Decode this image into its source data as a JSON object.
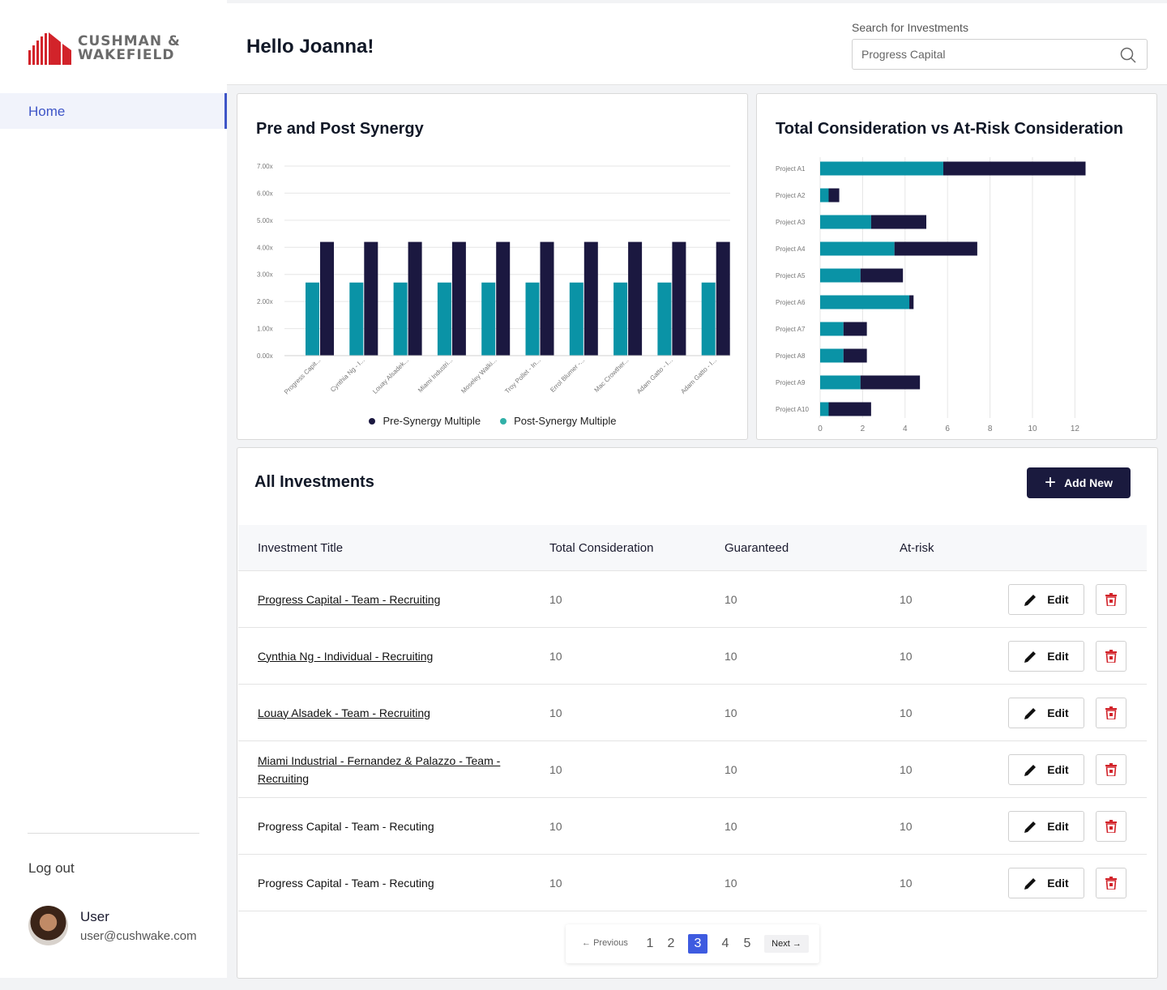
{
  "brand": {
    "name_line1": "CUSHMAN &",
    "name_line2": "WAKEFIELD",
    "accent": "#d2232a"
  },
  "sidebar": {
    "nav": [
      {
        "label": "Home",
        "active": true
      }
    ],
    "logout_label": "Log out",
    "user": {
      "name": "User",
      "email": "user@cushwake.com"
    }
  },
  "header": {
    "greeting": "Hello Joanna!",
    "search": {
      "label": "Search for Investments",
      "value": "Progress Capital",
      "placeholder": "Progress Capital"
    }
  },
  "colors": {
    "pre": "#1b1840",
    "post": "#0a93a6",
    "primary_button": "#1a1a3e",
    "active_page": "#3e5be0",
    "delete_icon": "#d2232a"
  },
  "charts": {
    "synergy": {
      "title": "Pre and Post Synergy"
    },
    "consideration": {
      "title": "Total Consideration vs At-Risk Consideration"
    }
  },
  "chart_data": [
    {
      "type": "bar",
      "title": "Pre and Post Synergy",
      "categories": [
        "Progress Capit...",
        "Cynthia Ng - I...",
        "Louay Alsadek...",
        "Miami Industri...",
        "Moseley Walki...",
        "Troy Pollet - In...",
        "Errol Blumer -...",
        "Mac Crowther...",
        "Adam Gatto - I...",
        "Adam Gatto - I..."
      ],
      "series": [
        {
          "name": "Pre-Synergy Multiple",
          "values": [
            4.2,
            4.2,
            4.2,
            4.2,
            4.2,
            4.2,
            4.2,
            4.2,
            4.2,
            4.2
          ]
        },
        {
          "name": "Post-Synergy Multiple",
          "values": [
            2.7,
            2.7,
            2.7,
            2.7,
            2.7,
            2.7,
            2.7,
            2.7,
            2.7,
            2.7
          ]
        }
      ],
      "ytick_labels": [
        "0.00x",
        "1.00x",
        "2.00x",
        "3.00x",
        "4.00x",
        "5.00x",
        "6.00x",
        "7.00x"
      ],
      "ylim": [
        0,
        7
      ],
      "grid": true,
      "legend": "bottom-center"
    },
    {
      "type": "bar",
      "orientation": "horizontal",
      "stacked": true,
      "title": "Total Consideration vs At-Risk Consideration",
      "categories": [
        "Project A1",
        "Project A2",
        "Project A3",
        "Project A4",
        "Project A5",
        "Project A6",
        "Project A7",
        "Project A8",
        "Project A9",
        "Project A10"
      ],
      "series": [
        {
          "values": [
            5.8,
            0.4,
            2.4,
            3.5,
            1.9,
            4.2,
            1.1,
            1.1,
            1.9,
            0.4
          ]
        },
        {
          "values": [
            6.7,
            0.5,
            2.6,
            3.9,
            2.0,
            0.2,
            1.1,
            1.1,
            2.8,
            2.0
          ]
        }
      ],
      "xticks": [
        0,
        2,
        4,
        6,
        8,
        10,
        12
      ],
      "xlim": [
        0,
        13
      ],
      "grid": true
    }
  ],
  "investments": {
    "title": "All Investments",
    "add_label": "Add New",
    "columns": [
      "Investment Title",
      "Total Consideration",
      "Guaranteed",
      "At-risk"
    ],
    "edit_label": "Edit",
    "rows": [
      {
        "title": "Progress Capital - Team - Recruiting",
        "total": "10",
        "guaranteed": "10",
        "at_risk": "10",
        "link": true
      },
      {
        "title": "Cynthia Ng - Individual - Recruiting",
        "total": "10",
        "guaranteed": "10",
        "at_risk": "10",
        "link": true
      },
      {
        "title": "Louay Alsadek - Team - Recruiting",
        "total": "10",
        "guaranteed": "10",
        "at_risk": "10",
        "link": true
      },
      {
        "title": "Miami Industrial - Fernandez & Palazzo - Team - Recruiting",
        "total": "10",
        "guaranteed": "10",
        "at_risk": "10",
        "link": true
      },
      {
        "title": "Progress Capital - Team - Recuting",
        "total": "10",
        "guaranteed": "10",
        "at_risk": "10",
        "link": false
      },
      {
        "title": "Progress Capital - Team - Recuting",
        "total": "10",
        "guaranteed": "10",
        "at_risk": "10",
        "link": false
      }
    ]
  },
  "pagination": {
    "prev_label": "Previous",
    "next_label": "Next",
    "pages": [
      "1",
      "2",
      "3",
      "4",
      "5"
    ],
    "current": "3"
  },
  "icons": {
    "search": "search-icon",
    "plus": "plus-icon",
    "edit": "pencil-icon",
    "delete": "trash-icon",
    "prev": "arrow-left-icon",
    "next": "arrow-right-icon"
  }
}
